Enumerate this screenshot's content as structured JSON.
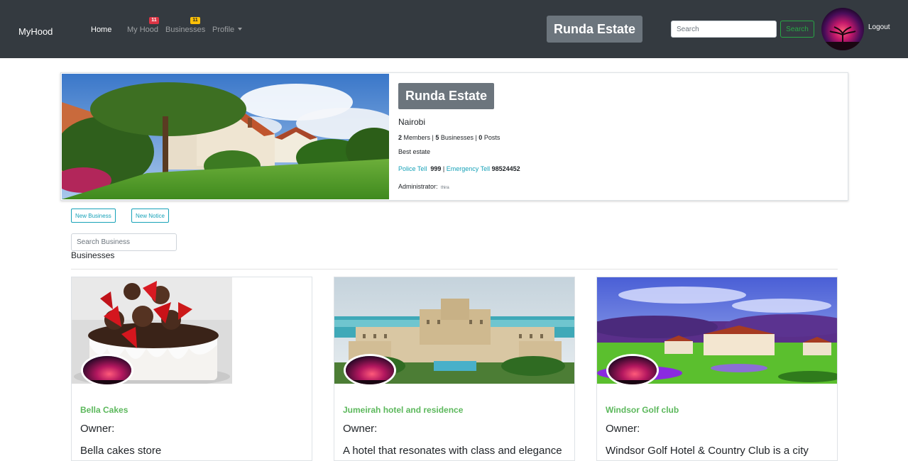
{
  "navbar": {
    "brand": "MyHood",
    "links": {
      "home": "Home",
      "my_hood": "My Hood",
      "businesses": "Businesses",
      "profile": "Profile"
    },
    "badges": {
      "my_hood": "11",
      "businesses": "11"
    },
    "estate_name": "Runda Estate",
    "search_placeholder": "Search",
    "search_button": "Search",
    "logout": "Logout"
  },
  "hood": {
    "name": "Runda Estate",
    "city": "Nairobi",
    "members_count": "2",
    "members_label": "Members",
    "businesses_count": "5",
    "businesses_label": "Businesses",
    "posts_count": "0",
    "posts_label": "Posts",
    "description": "Best estate",
    "police_label": "Police Tell",
    "police_number": "999",
    "emergency_label": "Emergency Tell",
    "emergency_number": "98524452",
    "admin_label": "Administrator:",
    "admin_name": "thira"
  },
  "actions": {
    "new_business": "New Business",
    "new_notice": "New Notice",
    "search_business_placeholder": "Search Business",
    "businesses_heading": "Businesses"
  },
  "businesses": [
    {
      "name": "Bella Cakes",
      "owner_label": "Owner:",
      "description": "Bella cakes store"
    },
    {
      "name": "Jumeirah hotel and residence",
      "owner_label": "Owner:",
      "description": "A hotel that resonates with class and elegance"
    },
    {
      "name": "Windsor Golf club",
      "owner_label": "Owner:",
      "description": "Windsor Golf Hotel & Country Club is a city"
    }
  ],
  "colors": {
    "navbar_bg": "#343a40",
    "pill_bg": "#6c757d",
    "success": "#28a745",
    "info": "#17a2b8",
    "business_name": "#5cb85c",
    "badge_red": "#dc3545",
    "badge_yellow": "#ffc107"
  }
}
